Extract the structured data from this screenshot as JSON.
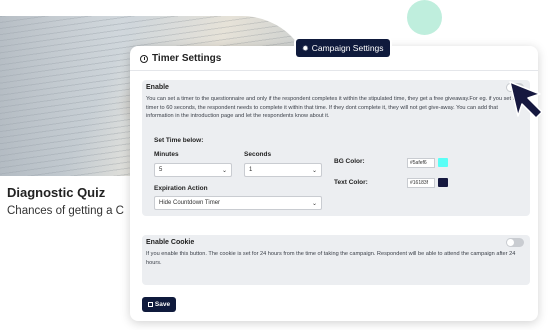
{
  "background": {
    "quiz_title": "Diagnostic Quiz",
    "quiz_subtitle": "Chances of getting a C"
  },
  "badge": {
    "label": "Campaign Settings",
    "icon": "gear-icon"
  },
  "panel": {
    "title": "Timer Settings",
    "icon": "clock-icon"
  },
  "timer_card": {
    "title": "Enable",
    "description": "You can set a timer to the questionnaire and only if the respondent completes it within the stipulated time, they get a free giveaway.For eg. if you set the timer to 60 seconds, the respondent needs to complete it within that time. If they dont complete it, they will not get give-away. You can add that information in the introduction page and let the respondents know about it.",
    "enabled": false,
    "set_time_label": "Set Time below:",
    "minutes_label": "Minutes",
    "minutes_value": "5",
    "seconds_label": "Seconds",
    "seconds_value": "1",
    "bg_color_label": "BG Color:",
    "bg_color_value": "#5afef6",
    "text_color_label": "Text Color:",
    "text_color_value": "#16183f",
    "expiration_label": "Expiration Action",
    "expiration_value": "Hide Countdown Timer"
  },
  "cookie_card": {
    "title": "Enable Cookie",
    "description": "If you enable this button. The cookie is set for 24 hours from the time of taking the campaign. Respondent will be able to attend the campaign after 24 hours.",
    "enabled": false
  },
  "save_button": {
    "label": "Save"
  },
  "colors": {
    "navy": "#0f1a3c",
    "bg_swatch": "#5afef6",
    "text_swatch": "#16183f"
  }
}
